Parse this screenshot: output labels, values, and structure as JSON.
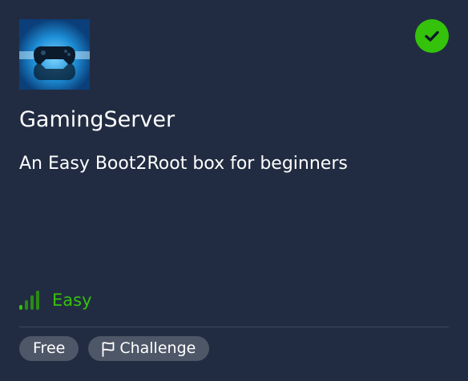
{
  "room": {
    "title": "GamingServer",
    "description": "An Easy Boot2Root box for beginners",
    "completed": true,
    "thumbnail_icon": "gamepad-image",
    "difficulty": {
      "label": "Easy",
      "level": 1,
      "max_level": 4,
      "color": "#35c20a"
    },
    "tags": [
      {
        "label": "Free",
        "icon": ""
      },
      {
        "label": "Challenge",
        "icon": "flag-icon"
      }
    ]
  },
  "colors": {
    "background": "#212c42",
    "success": "#35c20a",
    "tag_bg": "#4e5767"
  }
}
